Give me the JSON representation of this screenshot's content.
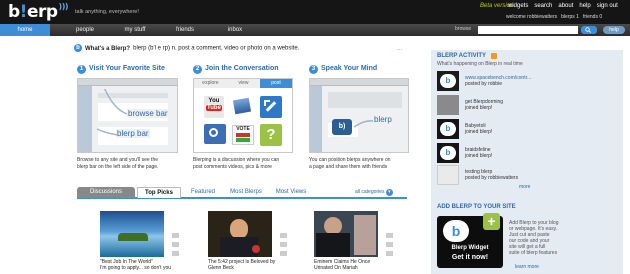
{
  "brand": {
    "logo_b": "b",
    "logo_ex": "!",
    "logo_rest": "erp",
    "waves": ")))",
    "tagline": "talk anything, everywhere!",
    "beta": "Beta version"
  },
  "toplinks": {
    "widgets": "widgets",
    "search": "search",
    "about": "about",
    "help": "help",
    "signout": "sign out"
  },
  "welcome": {
    "text": "welcome robbiewatters",
    "blerps": "blerps 1",
    "friends": "friends 0"
  },
  "nav": {
    "home": "home",
    "people": "people",
    "mystuff": "my stuff",
    "friends": "friends",
    "inbox": "inbox",
    "search_label": "browse",
    "search_placeholder": "",
    "help": "help"
  },
  "intro": {
    "title": "What's a Blerp?",
    "text": "blerp (b'l e rp) n. post a comment, video or photo on a website.",
    "more": "..."
  },
  "steps": [
    {
      "num": "1",
      "title": "Visit Your Favorite Site",
      "browse": "browse bar",
      "blerpbar": "blerp bar",
      "desc": [
        "Browse to any site and you'll see the",
        "blerp bar on the left side of the page."
      ]
    },
    {
      "num": "2",
      "title": "Join the Conversation",
      "tabs": [
        "explore",
        "view",
        "post"
      ],
      "vote": "VOTE",
      "desc": [
        "Blerping is a discussion where you can",
        "post comments videos, pics & more"
      ]
    },
    {
      "num": "3",
      "title": "Speak Your Mind",
      "blerp": "blerp",
      "desc": [
        "You can position blerps anywhere on",
        "a page and share them with friends"
      ]
    }
  ],
  "bottom_tabs": {
    "discussions": "Discussions",
    "toppicks": "Top Picks",
    "featured": "Featured",
    "mostblerps": "Most Blerps",
    "mostviews": "Most Views",
    "allcat": "all categories"
  },
  "captions": [
    {
      "title": "\"Best Job In The World\"",
      "sub": "I'm going to apply... so don't you"
    },
    {
      "title": "The 5:42 project is Beloved by",
      "sub": "Glenn Beck"
    },
    {
      "title": "Eminem Claims He Once",
      "sub": "Urinated On Mariah"
    }
  ],
  "sidebar": {
    "title": "BLERP ACTIVITY",
    "sub": "What's happening on Blerp in real time",
    "items": [
      {
        "line1": "www.spacebench.com/contr...",
        "line2": "posted by robbie"
      },
      {
        "line1": "get Blerpdorming",
        "line2": "joined blerp!"
      },
      {
        "line1": "Babyetoli",
        "line2": "joined blerp!"
      },
      {
        "line1": "braidsfeline",
        "line2": "joined blerp!"
      },
      {
        "line1": "testing blerp",
        "line2": "posted by robbiewatters"
      }
    ],
    "more": "more",
    "widget_title": "ADD BLERP TO YOUR SITE",
    "widget_name": "Blerp Widget",
    "widget_cta": "Get it now!",
    "widget_text": [
      "Add Blerp to your blog",
      "or webpage. It's easy.",
      "Just cut and paste",
      "our code and your",
      "site will get a full",
      "suite of blerp features"
    ],
    "widget_more": "learn more"
  }
}
